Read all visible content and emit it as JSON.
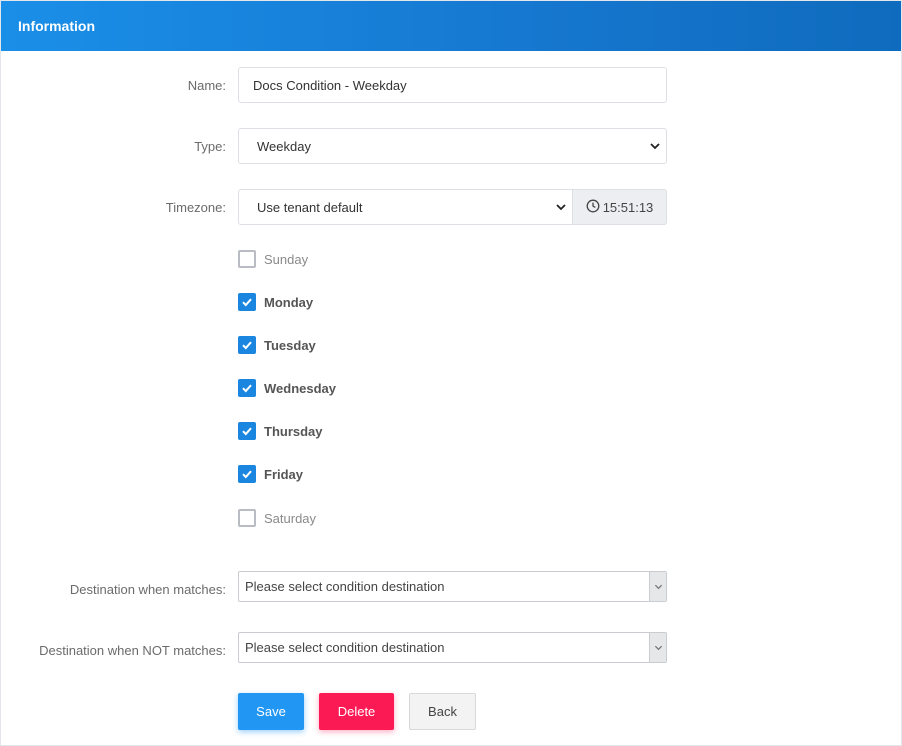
{
  "panel": {
    "title": "Information"
  },
  "form": {
    "name": {
      "label": "Name:",
      "value": "Docs Condition - Weekday"
    },
    "type": {
      "label": "Type:",
      "value": "Weekday"
    },
    "timezone": {
      "label": "Timezone:",
      "value": "Use tenant default",
      "clock": "15:51:13"
    },
    "days": [
      {
        "label": "Sunday",
        "checked": false
      },
      {
        "label": "Monday",
        "checked": true
      },
      {
        "label": "Tuesday",
        "checked": true
      },
      {
        "label": "Wednesday",
        "checked": true
      },
      {
        "label": "Thursday",
        "checked": true
      },
      {
        "label": "Friday",
        "checked": true
      },
      {
        "label": "Saturday",
        "checked": false
      }
    ],
    "dest_match": {
      "label": "Destination when matches:",
      "placeholder": "Please select condition destination"
    },
    "dest_not_match": {
      "label": "Destination when NOT matches:",
      "placeholder": "Please select condition destination"
    }
  },
  "buttons": {
    "save": "Save",
    "delete": "Delete",
    "back": "Back"
  },
  "colors": {
    "header": "#1a8fe8",
    "checkbox": "#1a86e0",
    "save": "#2196f3",
    "delete": "#fc1a55"
  },
  "icons": {
    "clock": "clock-icon",
    "chevron": "chevron-down-icon",
    "check": "check-icon"
  }
}
